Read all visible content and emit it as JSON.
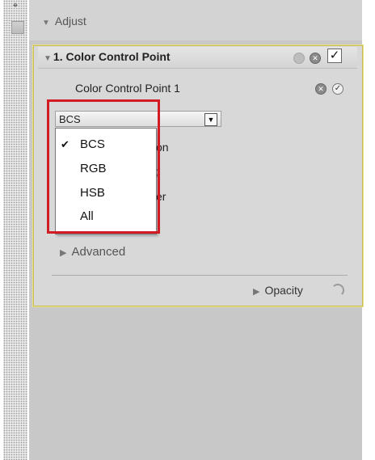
{
  "panel": {
    "adjust_title": "Adjust",
    "section_title": "1. Color Control Point",
    "control_point_label": "Color Control Point 1",
    "mode_select": {
      "selected": "BCS",
      "options": [
        "BCS",
        "RGB",
        "HSB",
        "All"
      ]
    },
    "behind_labels": [
      "on",
      ";",
      "er"
    ],
    "advanced_label": "Advanced",
    "opacity_label": "Opacity"
  },
  "icons": {
    "expand": "triangle-down-icon",
    "collapsed": "triangle-right-icon",
    "close": "close-icon",
    "check": "check-icon"
  },
  "colors": {
    "highlight_border": "#d21c24",
    "section_border": "#e8e082",
    "panel_bg": "#c8c8c8"
  }
}
